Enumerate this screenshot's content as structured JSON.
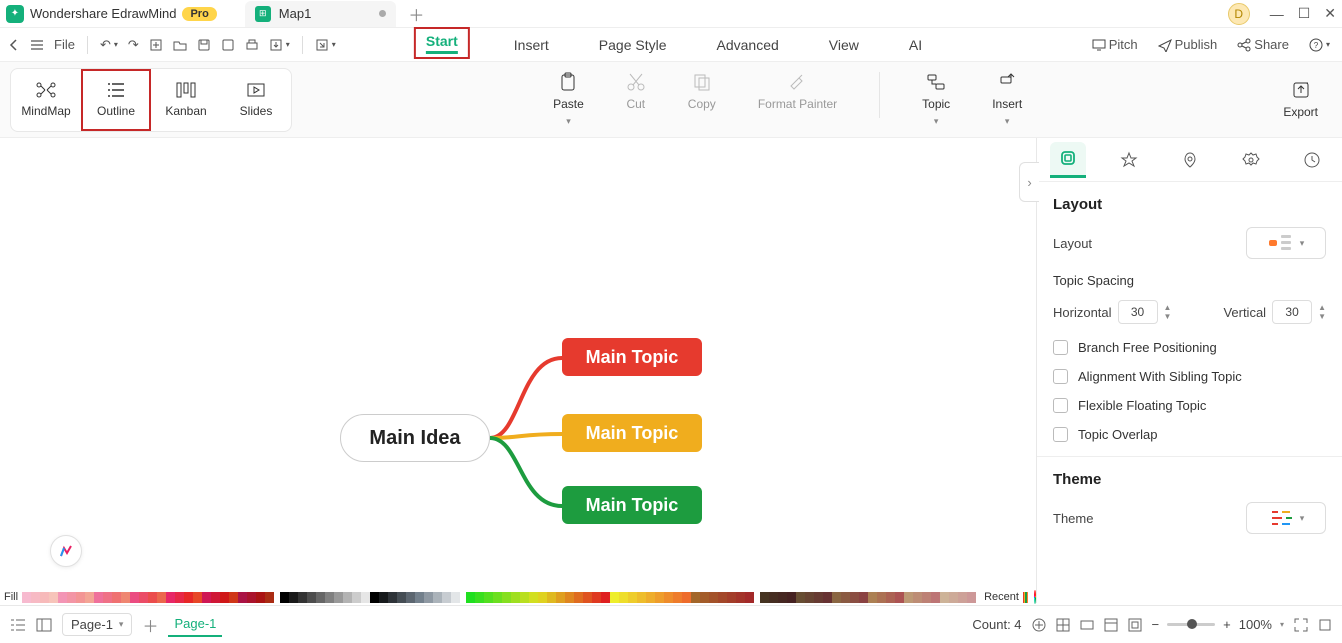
{
  "app": {
    "name": "Wondershare EdrawMind",
    "badge": "Pro",
    "avatar": "D"
  },
  "tabs": {
    "doc": "Map1"
  },
  "file_label": "File",
  "menu": {
    "start": "Start",
    "insert": "Insert",
    "pagestyle": "Page Style",
    "advanced": "Advanced",
    "view": "View",
    "ai": "AI"
  },
  "rightmenu": {
    "pitch": "Pitch",
    "publish": "Publish",
    "share": "Share"
  },
  "views": {
    "mindmap": "MindMap",
    "outline": "Outline",
    "kanban": "Kanban",
    "slides": "Slides"
  },
  "ribbon": {
    "paste": "Paste",
    "cut": "Cut",
    "copy": "Copy",
    "formatpainter": "Format Painter",
    "topic": "Topic",
    "insert": "Insert",
    "export": "Export"
  },
  "mind": {
    "idea": "Main Idea",
    "t1": "Main Topic",
    "t2": "Main Topic",
    "t3": "Main Topic"
  },
  "panel": {
    "layout_h": "Layout",
    "layout_l": "Layout",
    "spacing": "Topic Spacing",
    "horizontal": "Horizontal",
    "hval": "30",
    "vertical": "Vertical",
    "vval": "30",
    "branch": "Branch Free Positioning",
    "align": "Alignment With Sibling Topic",
    "flex": "Flexible Floating Topic",
    "overlap": "Topic Overlap",
    "theme_h": "Theme",
    "theme_l": "Theme"
  },
  "colorstrip": {
    "fill": "Fill",
    "recent": "Recent"
  },
  "status": {
    "page": "Page-1",
    "pagetab": "Page-1",
    "count": "Count: 4",
    "zoom": "100%"
  }
}
